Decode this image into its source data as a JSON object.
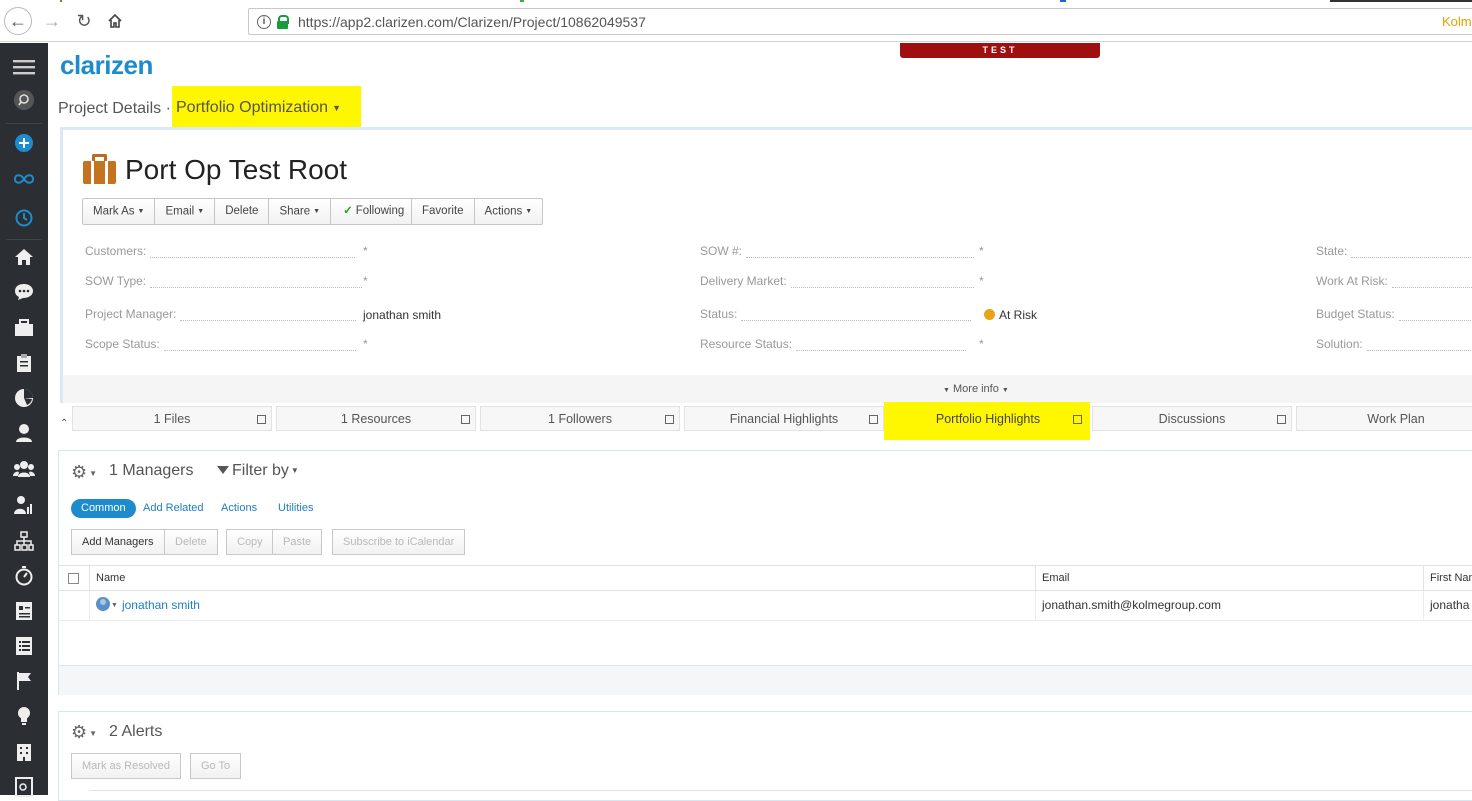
{
  "browser": {
    "url": "https://app2.clarizen.com/Clarizen/Project/10862049537",
    "url_right_text": "Kolm"
  },
  "app": {
    "logo": "clarizen",
    "env_banner": "TEST",
    "breadcrumb": "Project Details",
    "breadcrumb_sep": "·",
    "view_selector": "Portfolio Optimization"
  },
  "project": {
    "title": "Port Op Test Root",
    "toolbar1": [
      "Mark As",
      "Email",
      "Delete",
      "Share",
      "Following"
    ],
    "toolbar2": [
      "Favorite",
      "Actions"
    ],
    "fields": {
      "customers_label": "Customers:",
      "sow_type_label": "SOW Type:",
      "project_manager_label": "Project Manager:",
      "project_manager_value": "jonathan smith",
      "scope_status_label": "Scope Status:",
      "sow_num_label": "SOW #:",
      "delivery_market_label": "Delivery Market:",
      "status_label": "Status:",
      "status_value": "At Risk",
      "resource_status_label": "Resource Status:",
      "state_label": "State:",
      "work_at_risk_label": "Work At Risk:",
      "budget_status_label": "Budget Status:",
      "solution_label": "Solution:",
      "required_marker": "*"
    },
    "more_info": "More info",
    "status_color": "#e8a416"
  },
  "tabs": [
    "1 Files",
    "1 Resources",
    "1 Followers",
    "Financial Highlights",
    "Portfolio Highlights",
    "Discussions",
    "Work Plan"
  ],
  "managers": {
    "title": "1 Managers",
    "filter": "Filter by",
    "subtabs": [
      "Common",
      "Add Related",
      "Actions",
      "Utilities"
    ],
    "buttons": [
      "Add Managers",
      "Delete",
      "Copy",
      "Paste",
      "Subscribe to iCalendar"
    ],
    "columns": [
      "Name",
      "Email",
      "First Nam"
    ],
    "rows": [
      {
        "name": "jonathan smith",
        "email": "jonathan.smith@kolmegroup.com",
        "first_name": "jonatha"
      }
    ]
  },
  "alerts": {
    "title": "2 Alerts",
    "buttons": [
      "Mark as Resolved",
      "Go To"
    ]
  },
  "colors": {
    "accent": "#1e8ccc",
    "highlight": "#fff700",
    "sidebar": "#2b2f33",
    "test_banner": "#9f0f0f"
  }
}
